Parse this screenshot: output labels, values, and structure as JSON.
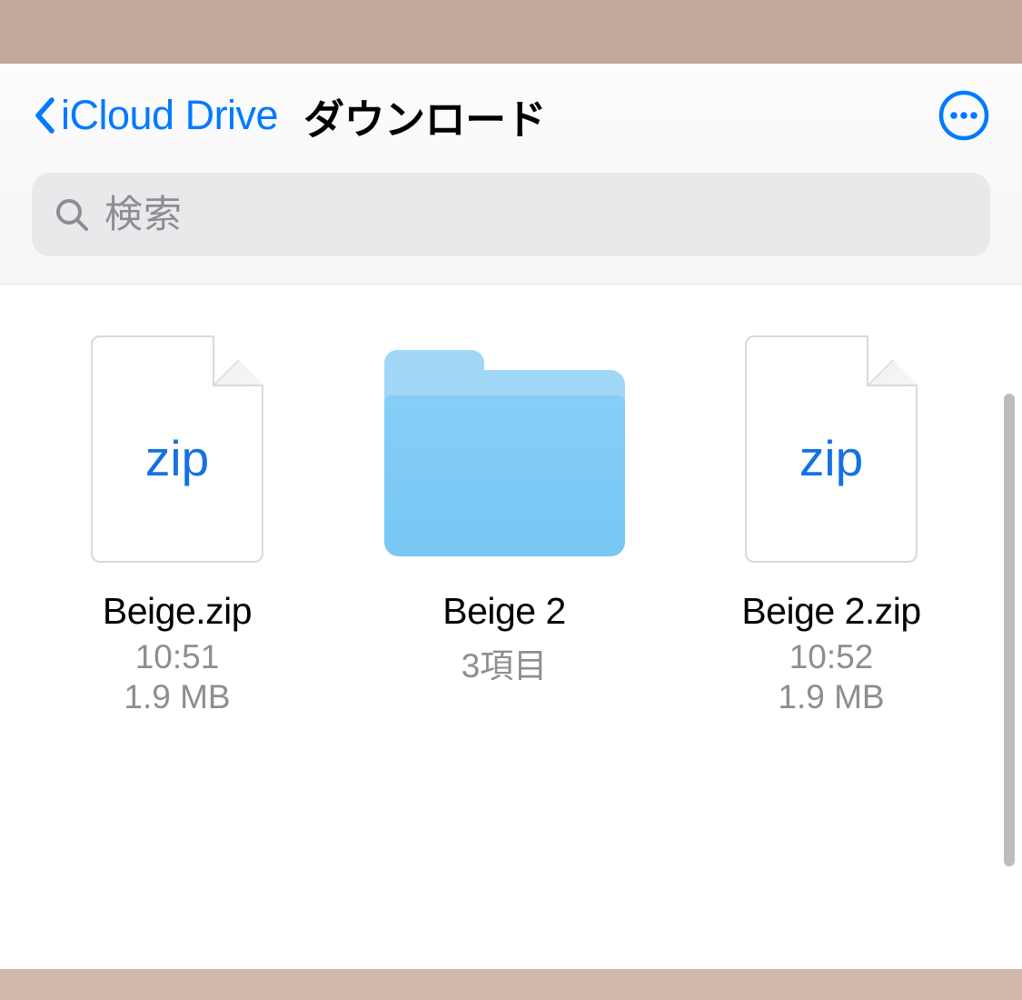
{
  "nav": {
    "back_label": "iCloud Drive",
    "title": "ダウンロード"
  },
  "search": {
    "placeholder": "検索"
  },
  "items": [
    {
      "type": "file",
      "ext": "zip",
      "name": "Beige.zip",
      "meta": "10:51",
      "size": "1.9 MB"
    },
    {
      "type": "folder",
      "name": "Beige 2",
      "meta": "3項目",
      "size": ""
    },
    {
      "type": "file",
      "ext": "zip",
      "name": "Beige 2.zip",
      "meta": "10:52",
      "size": "1.9 MB"
    }
  ]
}
